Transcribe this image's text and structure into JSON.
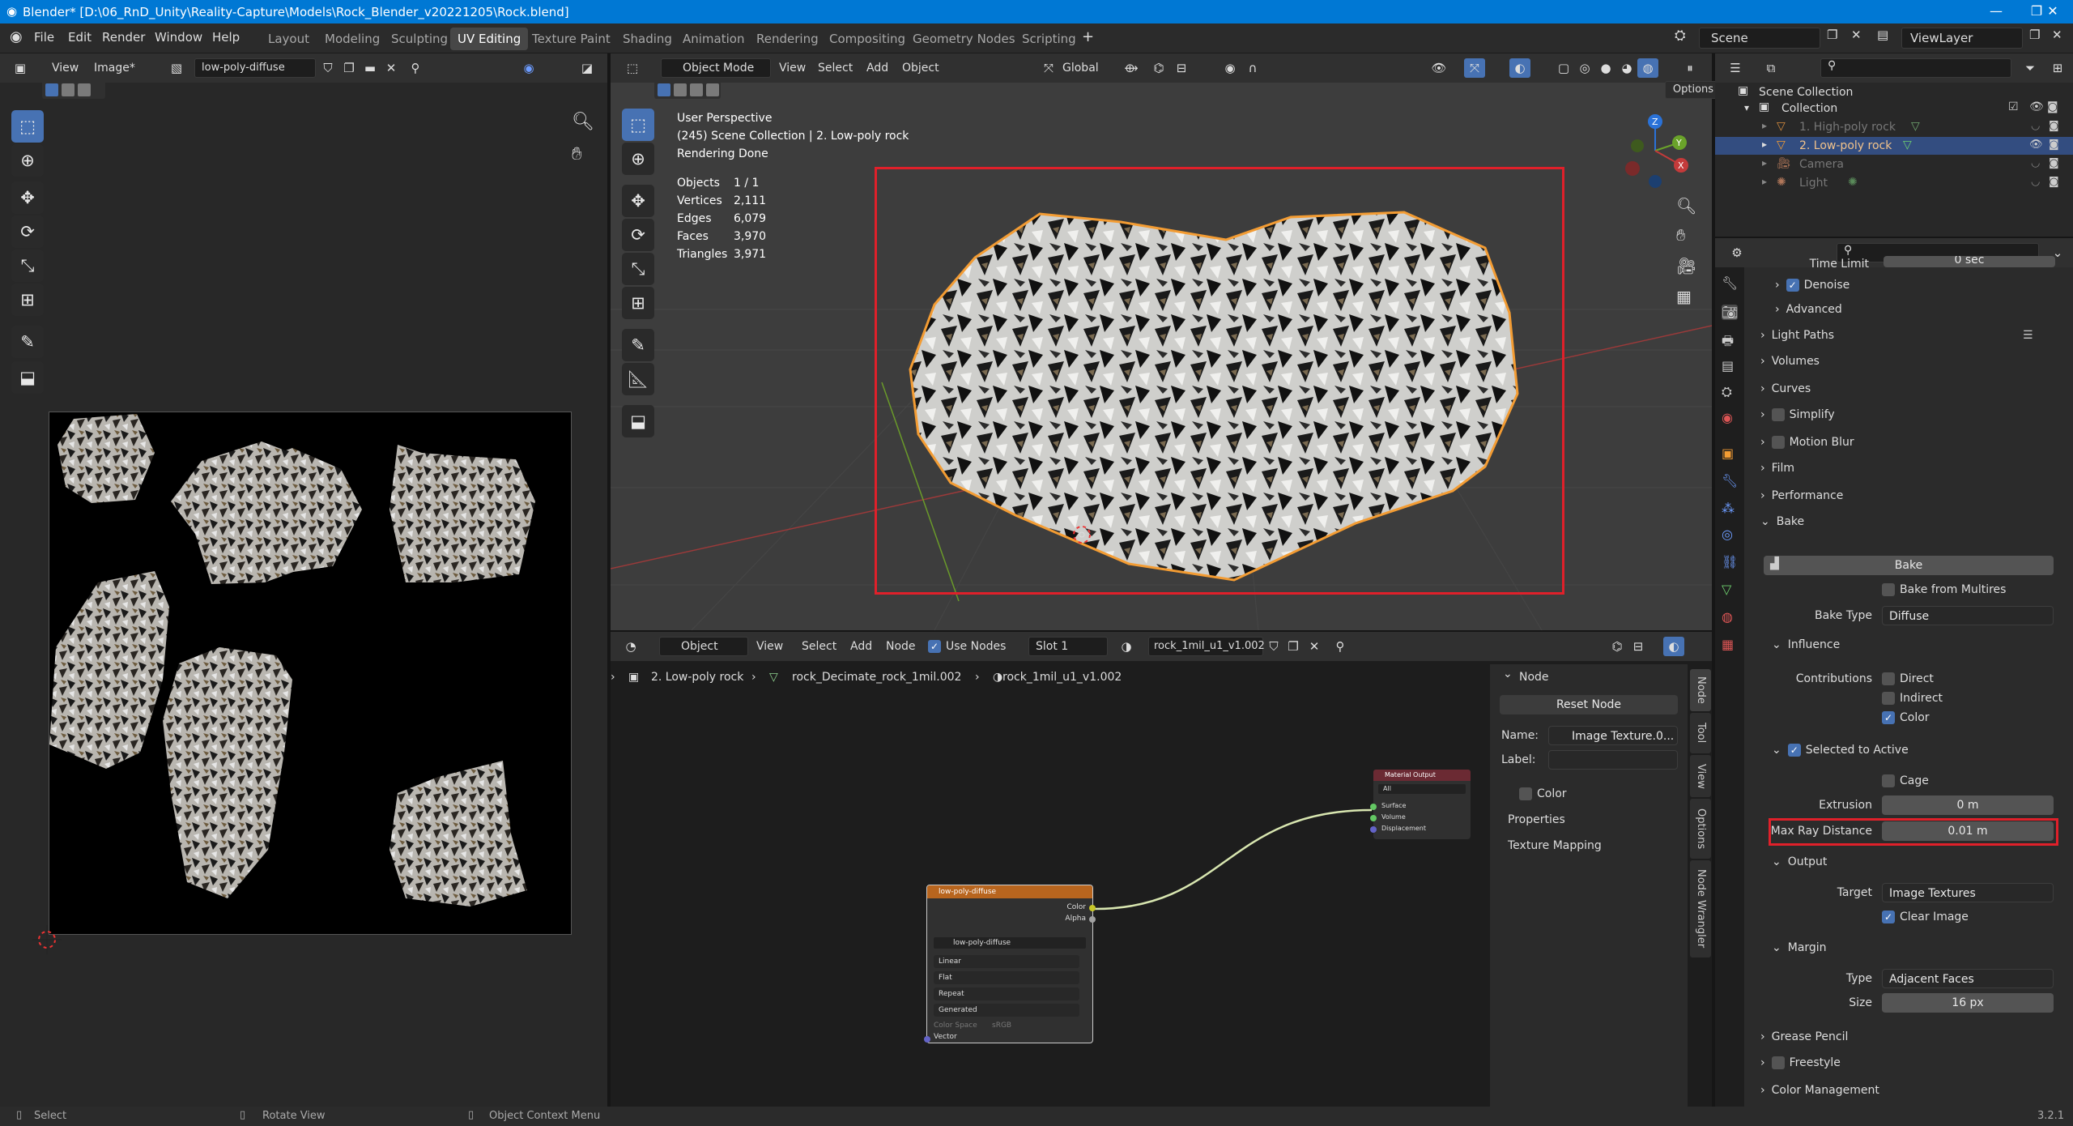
{
  "window": {
    "title": "Blender* [D:\\06_RnD_Unity\\Reality-Capture\\Models\\Rock_Blender_v20221205\\Rock.blend]",
    "controls": [
      "—",
      "❐",
      "✕"
    ]
  },
  "menu": [
    "File",
    "Edit",
    "Render",
    "Window",
    "Help"
  ],
  "workspaces": [
    "Layout",
    "Modeling",
    "Sculpting",
    "UV Editing",
    "Texture Paint",
    "Shading",
    "Animation",
    "Rendering",
    "Compositing",
    "Geometry Nodes",
    "Scripting"
  ],
  "active_workspace": "UV Editing",
  "scene": {
    "name": "Scene",
    "view_layer": "ViewLayer"
  },
  "image_editor": {
    "menus": [
      "View",
      "Image*"
    ],
    "image_name": "low-poly-diffuse"
  },
  "viewport": {
    "mode": "Object Mode",
    "menus": [
      "View",
      "Select",
      "Add",
      "Object"
    ],
    "transform": "Global",
    "options_label": "Options",
    "overlay_text": [
      "User Perspective",
      "(245) Scene Collection | 2. Low-poly rock",
      "Rendering Done"
    ],
    "stats": [
      {
        "label": "Objects",
        "value": "1 / 1"
      },
      {
        "label": "Vertices",
        "value": "2,111"
      },
      {
        "label": "Edges",
        "value": "6,079"
      },
      {
        "label": "Faces",
        "value": "3,970"
      },
      {
        "label": "Triangles",
        "value": "3,971"
      }
    ],
    "gizmo_axes": [
      "Z",
      "Y",
      "X"
    ]
  },
  "outliner": {
    "root": "Scene Collection",
    "collection": "Collection",
    "items": [
      {
        "label": "1. High-poly rock",
        "selected": false
      },
      {
        "label": "2. Low-poly rock",
        "selected": true
      },
      {
        "label": "Camera",
        "selected": false
      },
      {
        "label": "Light",
        "selected": false
      }
    ]
  },
  "properties": {
    "time_limit_label": "Time Limit",
    "time_limit_value": "0 sec",
    "denoise": "Denoise",
    "advanced": "Advanced",
    "panels_top": [
      "Light Paths",
      "Volumes",
      "Curves",
      "Simplify",
      "Motion Blur",
      "Film",
      "Performance"
    ],
    "bake_panel": "Bake",
    "bake_button": "Bake",
    "bake_from_multires": "Bake from Multires",
    "bake_type_label": "Bake Type",
    "bake_type_value": "Diffuse",
    "influence": "Influence",
    "contributions_label": "Contributions",
    "contributions": [
      {
        "label": "Direct",
        "checked": false
      },
      {
        "label": "Indirect",
        "checked": false
      },
      {
        "label": "Color",
        "checked": true
      }
    ],
    "selected_to_active": "Selected to Active",
    "cage": "Cage",
    "extrusion_label": "Extrusion",
    "extrusion_value": "0 m",
    "max_ray_label": "Max Ray Distance",
    "max_ray_value": "0.01 m",
    "output": "Output",
    "target_label": "Target",
    "target_value": "Image Textures",
    "clear_image": "Clear Image",
    "margin": "Margin",
    "type_label": "Type",
    "type_value": "Adjacent Faces",
    "size_label": "Size",
    "size_value": "16 px",
    "panels_bottom": [
      "Grease Pencil",
      "Freestyle",
      "Color Management"
    ]
  },
  "node_editor": {
    "type": "Object",
    "menus": [
      "View",
      "Select",
      "Add",
      "Node"
    ],
    "use_nodes": "Use Nodes",
    "slot": "Slot 1",
    "material": "rock_1mil_u1_v1.002",
    "breadcrumb": [
      "2. Low-poly rock",
      "rock_Decimate_rock_1mil.002",
      "rock_1mil_u1_v1.002"
    ],
    "image_node": {
      "title": "low-poly-diffuse",
      "outputs": [
        "Color",
        "Alpha"
      ],
      "image": "low-poly-diffuse",
      "options": [
        "Linear",
        "Flat",
        "Repeat",
        "Generated"
      ],
      "color_space_label": "Color Space",
      "color_space_value": "sRGB",
      "input": "Vector"
    },
    "output_node": {
      "title": "Material Output",
      "target": "All",
      "inputs": [
        "Surface",
        "Volume",
        "Displacement"
      ]
    },
    "sidebar": {
      "header": "Node",
      "reset": "Reset Node",
      "name_label": "Name:",
      "name_value": "Image Texture.0...",
      "label_label": "Label:",
      "color": "Color",
      "properties": "Properties",
      "texture_mapping": "Texture Mapping",
      "tabs": [
        "Node",
        "Tool",
        "View",
        "Options",
        "Node Wrangler"
      ]
    }
  },
  "statusbar": {
    "items": [
      "Select",
      "Rotate View",
      "Object Context Menu"
    ],
    "version": "3.2.1"
  },
  "colors": {
    "accent": "#4772b3",
    "highlight_box": "#e0202a",
    "title_bar": "#0078d4",
    "selection_outline": "#f39c33"
  }
}
